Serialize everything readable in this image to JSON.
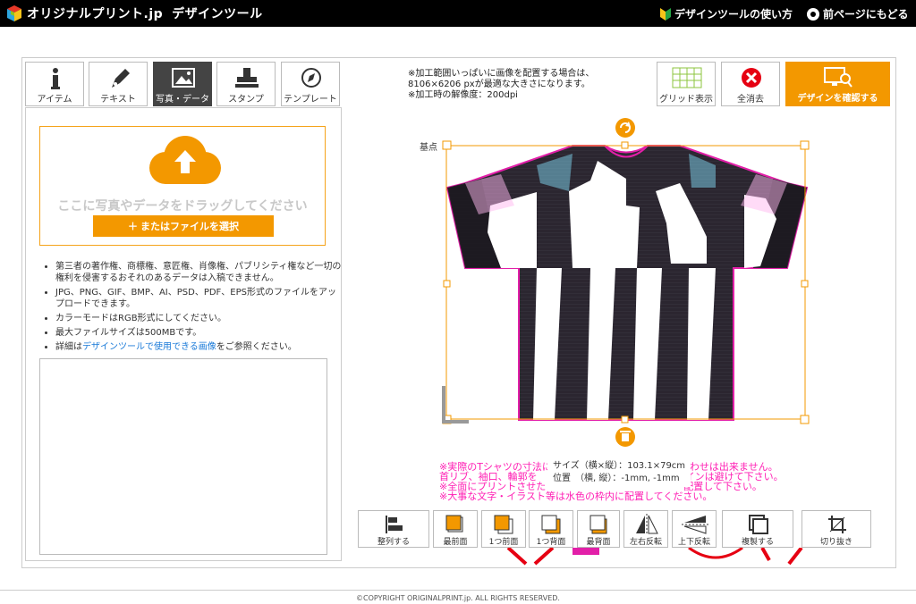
{
  "header": {
    "logo_text": "オリジナルプリント.jp",
    "app_title": "デザインツール",
    "help_link": "デザインツールの使い方",
    "back_link": "前ページにもどる"
  },
  "tabs": [
    {
      "label": "アイテム",
      "icon": "info-icon"
    },
    {
      "label": "テキスト",
      "icon": "pen-icon"
    },
    {
      "label": "写真・データ",
      "icon": "image-icon"
    },
    {
      "label": "スタンプ",
      "icon": "stamp-icon"
    },
    {
      "label": "テンプレート",
      "icon": "compass-icon"
    }
  ],
  "upload": {
    "drop_text": "ここに写真やデータをドラッグしてください",
    "select_button": "＋ またはファイルを選択"
  },
  "notes": {
    "n1": "第三者の著作権、商標権、意匠権、肖像権、パブリシティ権など一切の権利を侵害するおそれのあるデータは入稿できません。",
    "n2": "JPG、PNG、GIF、BMP、AI、PSD、PDF、EPS形式のファイルをアップロードできます。",
    "n3": "カラーモードはRGB形式にしてください。",
    "n4": "最大ファイルサイズは500MBです。",
    "n5_pre": "詳細は",
    "n5_link": "デザインツールで使用できる画像",
    "n5_post": "をご参照ください。"
  },
  "canvas_info": {
    "line1": "※加工範囲いっぱいに画像を配置する場合は、",
    "line2": "8106×6206 pxが最適な大きさになります。",
    "line3": "※加工時の解像度：200dpi"
  },
  "toolbar": {
    "grid": "グリッド表示",
    "clear": "全消去",
    "confirm": "デザインを確認する"
  },
  "canvas": {
    "base_point": "基点",
    "size_label": "サイズ（横×縦）：103.1×79cm",
    "position_label": "位置　（横, 縦）：-1mm, -1mm"
  },
  "warnings": {
    "w1": "※実際のTシャツの寸法に　　　　　　　　　　　　　　わせは出来ません。",
    "w2": "首リブ、袖口、輪郭を　　　　　　　　　　　　　　　インは避けて下さい。",
    "w3": "※全面にプリントさせた　　　　　　　　　　　　　　配置して下さい。",
    "w4": "※大事な文字・イラスト等は水色の枠内に配置してください。"
  },
  "bottom_tools": [
    {
      "label": "整列する",
      "icon": "align-icon"
    },
    {
      "label": "最前面",
      "icon": "bring-front-icon"
    },
    {
      "label": "1つ前面",
      "icon": "bring-forward-icon"
    },
    {
      "label": "1つ背面",
      "icon": "send-backward-icon"
    },
    {
      "label": "最背面",
      "icon": "send-back-icon"
    },
    {
      "label": "左右反転",
      "icon": "flip-horizontal-icon"
    },
    {
      "label": "上下反転",
      "icon": "flip-vertical-icon"
    },
    {
      "label": "複製する",
      "icon": "duplicate-icon"
    },
    {
      "label": "切り抜き",
      "icon": "crop-icon"
    }
  ],
  "footer": "©COPYRIGHT ORIGINALPRINT.jp. ALL RIGHTS RESERVED.",
  "colors": {
    "accent": "#f39800",
    "warning": "#ff1fb4",
    "link": "#1a7ad8"
  }
}
